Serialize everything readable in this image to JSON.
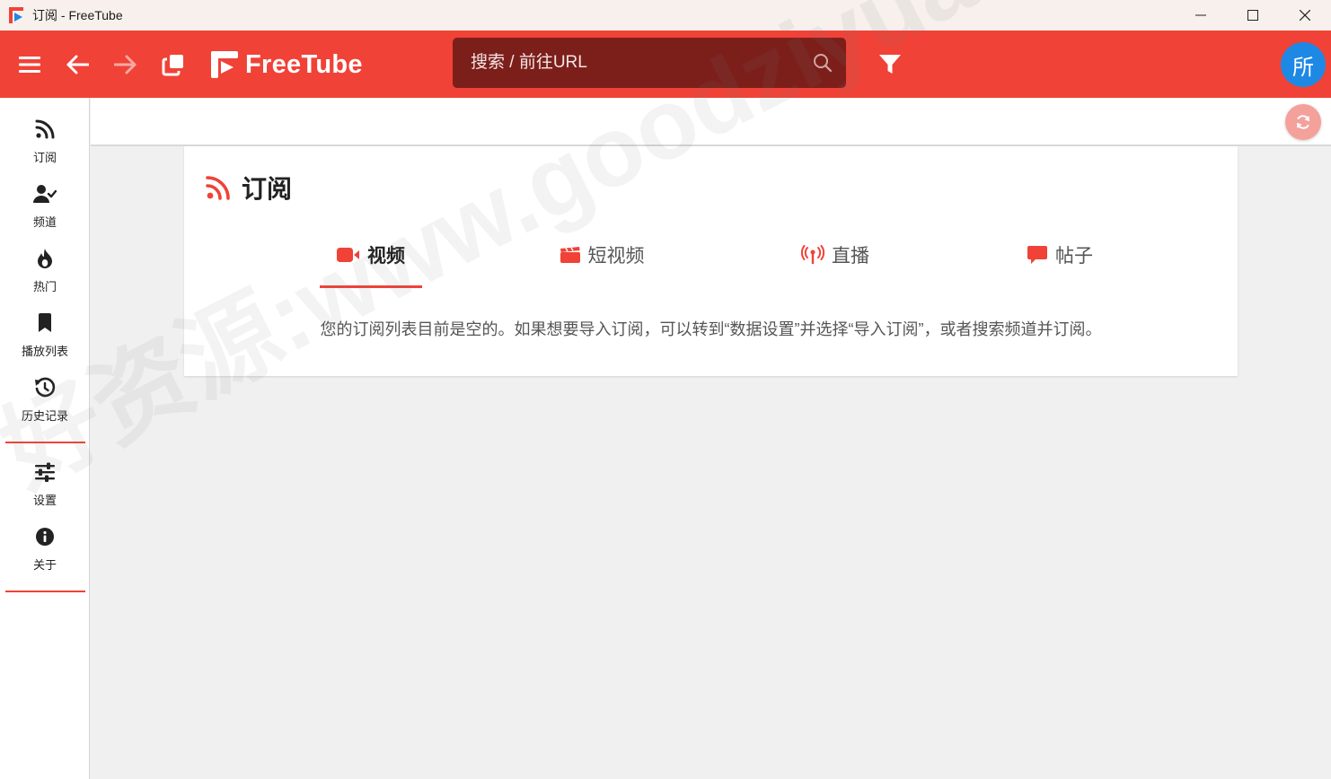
{
  "window": {
    "title": "订阅 - FreeTube"
  },
  "header": {
    "brand": "FreeTube",
    "search_placeholder": "搜索 / 前往URL",
    "avatar_letter": "所",
    "accent_color": "#f04237",
    "avatar_color": "#1e88e5"
  },
  "sidebar": {
    "items": [
      {
        "label": "订阅",
        "icon": "rss-icon"
      },
      {
        "label": "频道",
        "icon": "user-check-icon"
      },
      {
        "label": "热门",
        "icon": "fire-icon"
      },
      {
        "label": "播放列表",
        "icon": "bookmark-icon"
      },
      {
        "label": "历史记录",
        "icon": "history-icon"
      },
      {
        "label": "设置",
        "icon": "sliders-icon"
      },
      {
        "label": "关于",
        "icon": "info-icon"
      }
    ]
  },
  "main": {
    "page_title": "订阅",
    "tabs": [
      {
        "label": "视频",
        "icon": "video-camera-icon",
        "active": true
      },
      {
        "label": "短视频",
        "icon": "clapperboard-icon",
        "active": false
      },
      {
        "label": "直播",
        "icon": "broadcast-tower-icon",
        "active": false
      },
      {
        "label": "帖子",
        "icon": "comment-icon",
        "active": false
      }
    ],
    "empty_message": "您的订阅列表目前是空的。如果想要导入订阅，可以转到“数据设置”并选择“导入订阅”，或者搜索频道并订阅。"
  },
  "watermark": "好资源:www.goodziyuan.com"
}
